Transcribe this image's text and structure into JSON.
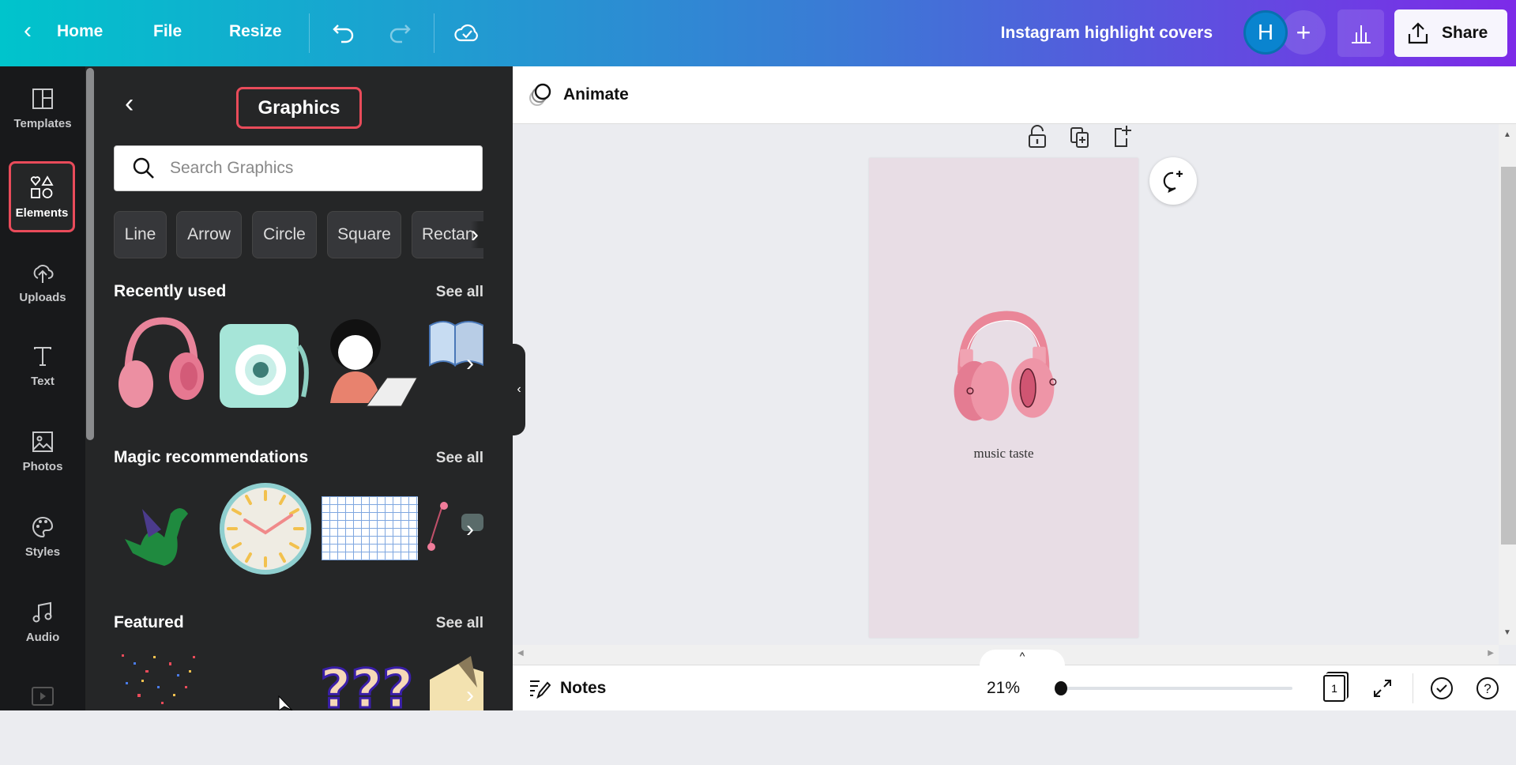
{
  "topbar": {
    "home": "Home",
    "file": "File",
    "resize": "Resize",
    "title": "Instagram highlight covers",
    "avatar_initial": "H",
    "add": "+",
    "share": "Share",
    "gradient": [
      "#00c4cc",
      "#7d2ae8"
    ]
  },
  "rail": {
    "items": [
      {
        "label": "Templates",
        "icon": "layout-icon"
      },
      {
        "label": "Elements",
        "icon": "shapes-icon"
      },
      {
        "label": "Uploads",
        "icon": "cloud-upload-icon"
      },
      {
        "label": "Text",
        "icon": "text-icon"
      },
      {
        "label": "Photos",
        "icon": "image-icon"
      },
      {
        "label": "Styles",
        "icon": "palette-icon"
      },
      {
        "label": "Audio",
        "icon": "music-icon"
      },
      {
        "label": "",
        "icon": "video-icon"
      }
    ]
  },
  "panel": {
    "title": "Graphics",
    "search_placeholder": "Search Graphics",
    "chips": [
      "Line",
      "Arrow",
      "Circle",
      "Square",
      "Rectan"
    ],
    "sections": [
      {
        "title": "Recently used",
        "see_all": "See all"
      },
      {
        "title": "Magic recommendations",
        "see_all": "See all"
      },
      {
        "title": "Featured",
        "see_all": "See all"
      }
    ]
  },
  "editor": {
    "animate": "Animate",
    "canvas_text": "music taste",
    "page_bg": "#e8dde5"
  },
  "bottom": {
    "notes": "Notes",
    "zoom": "21%",
    "zoom_level_percent": 21,
    "page_count": "1"
  }
}
